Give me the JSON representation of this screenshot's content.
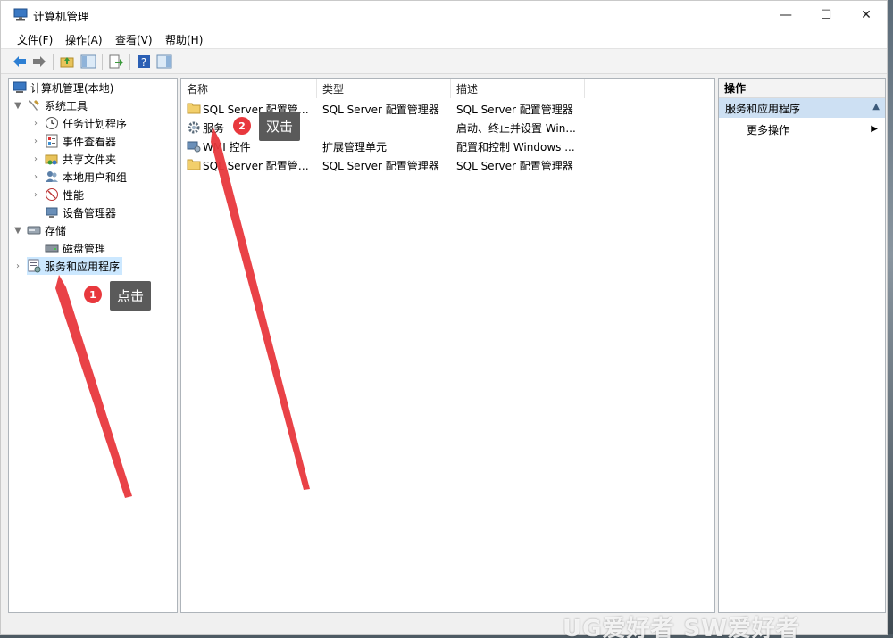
{
  "window": {
    "title": "计算机管理",
    "controls": {
      "minimize": "—",
      "maximize": "☐",
      "close": "✕"
    }
  },
  "menu": [
    "文件(F)",
    "操作(A)",
    "查看(V)",
    "帮助(H)"
  ],
  "tree": {
    "root": "计算机管理(本地)",
    "system_tools": "系统工具",
    "task_scheduler": "任务计划程序",
    "event_viewer": "事件查看器",
    "shared_folders": "共享文件夹",
    "local_users": "本地用户和组",
    "performance": "性能",
    "device_manager": "设备管理器",
    "storage": "存储",
    "disk_management": "磁盘管理",
    "services_apps": "服务和应用程序"
  },
  "list": {
    "columns": [
      "名称",
      "类型",
      "描述"
    ],
    "rows": [
      {
        "name": "SQL Server 配置管理...",
        "type": "SQL Server 配置管理器",
        "desc": "SQL Server 配置管理器"
      },
      {
        "name": "服务",
        "type": "",
        "desc": "启动、终止并设置 Win..."
      },
      {
        "name": "WMI 控件",
        "type": "扩展管理单元",
        "desc": "配置和控制 Windows ..."
      },
      {
        "name": "SQL Server 配置管理...",
        "type": "SQL Server 配置管理器",
        "desc": "SQL Server 配置管理器"
      }
    ]
  },
  "actions": {
    "header": "操作",
    "section": "服务和应用程序",
    "more": "更多操作"
  },
  "annotations": {
    "step1_number": "1",
    "step1_label": "点击",
    "step2_number": "2",
    "step2_label": "双击",
    "arrow_color": "#e8383d"
  },
  "watermark": "UG爱好者 SW爱好者"
}
